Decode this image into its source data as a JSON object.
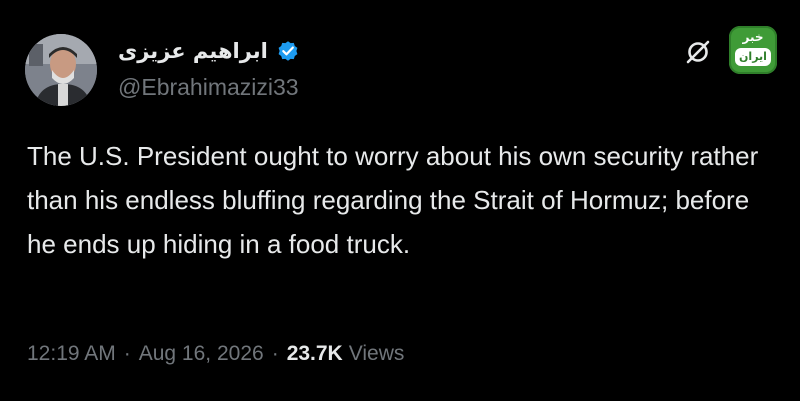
{
  "author": {
    "display_name": "ابراهیم عزیزی",
    "handle": "@Ebrahimazizi33",
    "verified": true
  },
  "tweet": {
    "text": "The U.S. President ought to worry about his own security rather than his endless bluffing regarding the Strait of Hormuz; before he ends up hiding in a food truck.",
    "time": "12:19 AM",
    "date": "Aug 16, 2026",
    "separator": "·",
    "views_count": "23.7K",
    "views_label": "Views"
  },
  "badge": {
    "top_text": "خبر",
    "bottom_text": "ایران"
  },
  "colors": {
    "background": "#000000",
    "primary_text": "#e7e9ea",
    "secondary_text": "#71767b",
    "verified_blue": "#1d9bf0",
    "badge_green": "#3f9b37"
  },
  "icons": {
    "verified": "verified-badge-icon",
    "brand": "x-logo-icon",
    "avatar": "profile-photo"
  }
}
